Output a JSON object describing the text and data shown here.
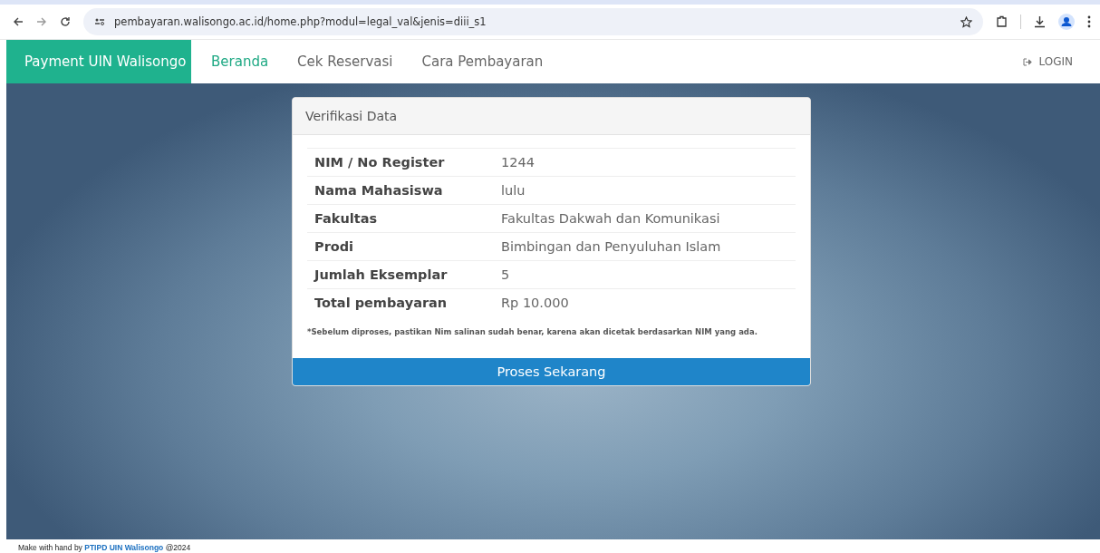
{
  "browser": {
    "url": "pembayaran.walisongo.ac.id/home.php?modul=legal_val&jenis=diii_s1"
  },
  "navbar": {
    "brand": "Payment UIN Walisongo",
    "items": [
      {
        "label": "Beranda",
        "selected": true
      },
      {
        "label": "Cek Reservasi",
        "selected": false
      },
      {
        "label": "Cara Pembayaran",
        "selected": false
      }
    ],
    "login": "LOGIN"
  },
  "card": {
    "title": "Verifikasi Data",
    "rows": [
      {
        "label": "NIM / No Register",
        "value": "1244"
      },
      {
        "label": "Nama Mahasiswa",
        "value": "lulu"
      },
      {
        "label": "Fakultas",
        "value": "Fakultas Dakwah dan Komunikasi"
      },
      {
        "label": "Prodi",
        "value": "Bimbingan dan Penyuluhan Islam"
      },
      {
        "label": "Jumlah Eksemplar",
        "value": "5"
      },
      {
        "label": "Total pembayaran",
        "value": "Rp 10.000"
      }
    ],
    "note": "*Sebelum diproses, pastikan Nim salinan sudah benar, karena akan dicetak berdasarkan NIM yang ada.",
    "button": "Proses Sekarang"
  },
  "footer": {
    "prefix": "Make with hand by",
    "link": "PTIPD UIN Walisongo",
    "suffix": "@2024"
  }
}
